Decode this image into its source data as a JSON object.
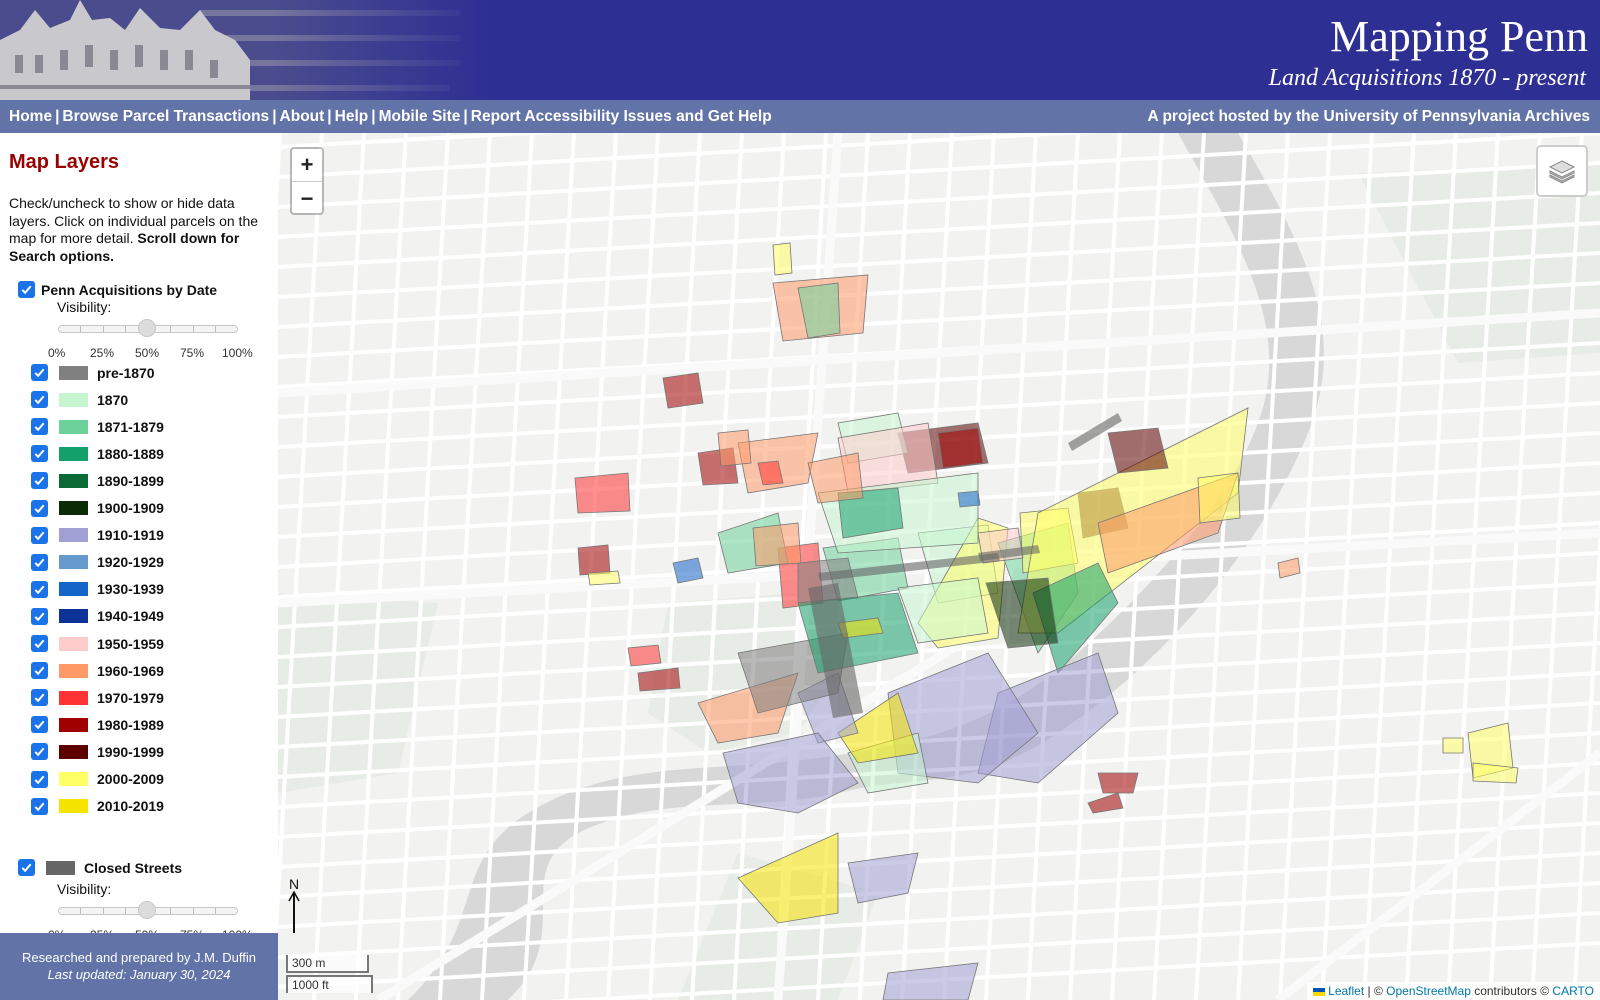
{
  "header": {
    "title": "Mapping Penn",
    "subtitle": "Land Acquisitions 1870 - present"
  },
  "nav": {
    "links": [
      "Home",
      "Browse Parcel Transactions",
      "About",
      "Help",
      "Mobile Site",
      "Report Accessibility Issues and Get Help"
    ],
    "host_prefix": "A project hosted by the ",
    "host_name": "University of Pennsylvania Archives"
  },
  "sidebar": {
    "title": "Map Layers",
    "intro_text": "Check/uncheck to show or hide data layers. Click on individual parcels on the map for more detail. ",
    "intro_bold": "Scroll down for Search options.",
    "layer1": {
      "label": "Penn Acquisitions by Date",
      "checked": true
    },
    "visibility_label": "Visibility:",
    "slider_ticks": [
      "0%",
      "25%",
      "50%",
      "75%",
      "100%"
    ],
    "slider_value_percent": 50,
    "legend": [
      {
        "label": "pre-1870",
        "color": "#808080"
      },
      {
        "label": "1870",
        "color": "#c7f5cf"
      },
      {
        "label": "1871-1879",
        "color": "#6dd19a"
      },
      {
        "label": "1880-1889",
        "color": "#14a06a"
      },
      {
        "label": "1890-1899",
        "color": "#0a6b35"
      },
      {
        "label": "1900-1909",
        "color": "#0b2a06"
      },
      {
        "label": "1910-1919",
        "color": "#a0a0d4"
      },
      {
        "label": "1920-1929",
        "color": "#6699cc"
      },
      {
        "label": "1930-1939",
        "color": "#1565c8"
      },
      {
        "label": "1940-1949",
        "color": "#0d3296"
      },
      {
        "label": "1950-1959",
        "color": "#ffcccc"
      },
      {
        "label": "1960-1969",
        "color": "#ff9966"
      },
      {
        "label": "1970-1979",
        "color": "#ff3333"
      },
      {
        "label": "1980-1989",
        "color": "#a10000"
      },
      {
        "label": "1990-1999",
        "color": "#5c0000"
      },
      {
        "label": "2000-2009",
        "color": "#ffff66"
      },
      {
        "label": "2010-2019",
        "color": "#f5e400"
      }
    ],
    "layer2": {
      "label": "Closed Streets",
      "checked": true,
      "color": "#666666"
    }
  },
  "credits": {
    "line1": "Researched and prepared by J.M. Duffin",
    "line2": "Last updated: January 30, 2024"
  },
  "map": {
    "zoom_in": "+",
    "zoom_out": "−",
    "north_label": "N",
    "scale_metric": "300 m",
    "scale_imperial": "1000 ft",
    "attribution": {
      "leaflet": "Leaflet",
      "sep1": " | © ",
      "osm": "OpenStreetMap",
      "mid": " contributors © ",
      "carto": "CARTO"
    }
  }
}
